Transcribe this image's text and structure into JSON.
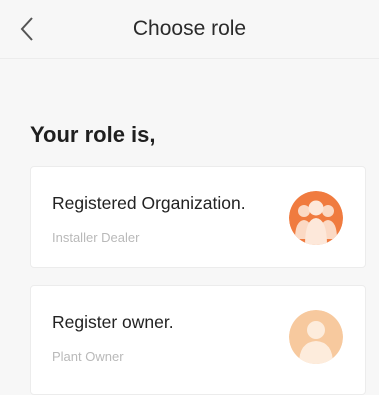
{
  "header": {
    "title": "Choose role",
    "back_icon": "chevron-left-icon"
  },
  "main": {
    "heading": "Your role is,",
    "roles": [
      {
        "title": "Registered Organization.",
        "subtitle": "Installer Dealer",
        "icon": "group-users-icon",
        "color": "#f07b3f"
      },
      {
        "title": "Register owner.",
        "subtitle": "Plant Owner",
        "icon": "single-user-icon",
        "color": "#f7c99e"
      }
    ]
  }
}
